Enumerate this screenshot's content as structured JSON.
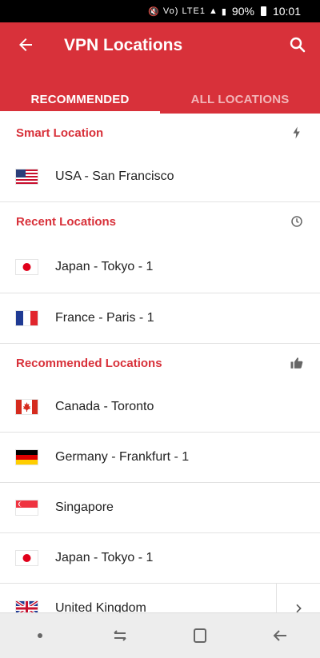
{
  "status": {
    "percent": "90%",
    "time": "10:01",
    "net": "Vo) LTE1"
  },
  "header": {
    "title": "VPN Locations"
  },
  "tabs": [
    {
      "label": "RECOMMENDED"
    },
    {
      "label": "ALL LOCATIONS"
    }
  ],
  "sections": {
    "smart": {
      "label": "Smart Location",
      "items": [
        {
          "name": "USA - San Francisco",
          "flag": "us-flag"
        }
      ]
    },
    "recent": {
      "label": "Recent Locations",
      "items": [
        {
          "name": "Japan - Tokyo - 1",
          "flag": "jp-flag"
        },
        {
          "name": "France - Paris - 1",
          "flag": "fr-flag"
        }
      ]
    },
    "recommended": {
      "label": "Recommended Locations",
      "items": [
        {
          "name": "Canada - Toronto",
          "flag": "ca-flag"
        },
        {
          "name": "Germany - Frankfurt - 1",
          "flag": "de-flag"
        },
        {
          "name": "Singapore",
          "flag": "sg-flag"
        },
        {
          "name": "Japan - Tokyo - 1",
          "flag": "jp-flag"
        },
        {
          "name": "United Kingdom",
          "flag": "gb-flag"
        }
      ]
    }
  },
  "colors": {
    "brand": "#d8313a",
    "text": "#222222",
    "divider": "#e2e2e2"
  }
}
